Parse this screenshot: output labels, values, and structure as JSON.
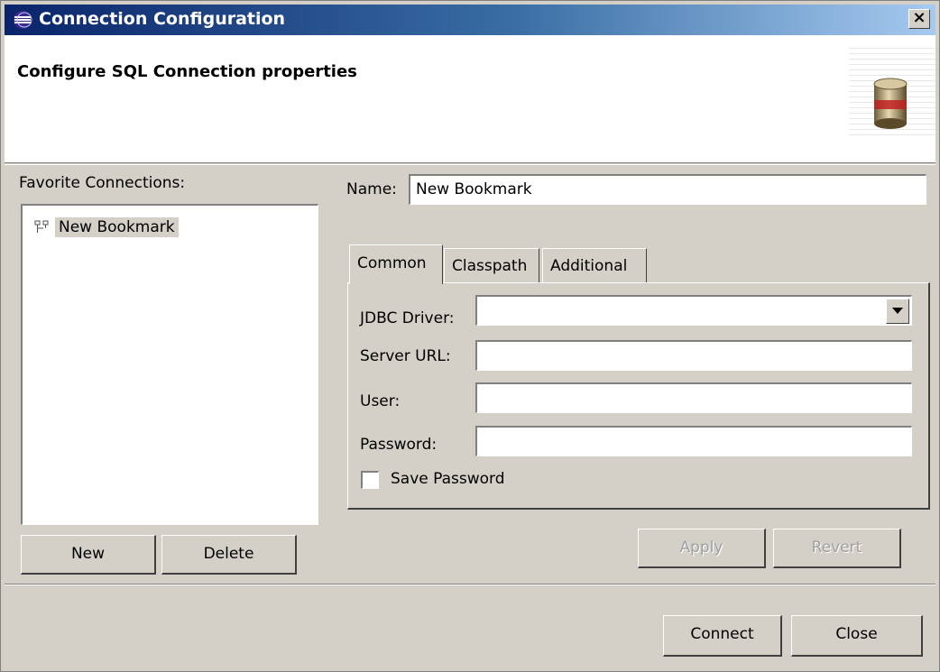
{
  "window": {
    "title": "Connection Configuration",
    "close_label": "×"
  },
  "banner": {
    "title": "Configure SQL Connection properties",
    "icon": "database-icon"
  },
  "favorites": {
    "label": "Favorite Connections:",
    "items": [
      {
        "label": "New Bookmark",
        "icon": "bookmark-tree-icon"
      }
    ],
    "new_button": "New",
    "delete_button": "Delete"
  },
  "details": {
    "name_label": "Name:",
    "name_value": "New Bookmark",
    "tabs": [
      {
        "label": "Common",
        "active": true
      },
      {
        "label": "Classpath",
        "active": false
      },
      {
        "label": "Additional",
        "active": false
      }
    ],
    "fields": {
      "jdbc_driver_label": "JDBC Driver:",
      "jdbc_driver_value": "",
      "server_url_label": "Server URL:",
      "server_url_value": "",
      "user_label": "User:",
      "user_value": "",
      "password_label": "Password:",
      "password_value": ""
    },
    "save_password_label": "Save Password",
    "save_password_checked": false,
    "apply_button": "Apply",
    "revert_button": "Revert"
  },
  "footer": {
    "connect_button": "Connect",
    "close_button": "Close"
  },
  "colors": {
    "title_start": "#0a246a",
    "title_end": "#a6caf0",
    "dialog_bg": "#d4d0c8",
    "disabled_text": "#a0a0a0"
  }
}
